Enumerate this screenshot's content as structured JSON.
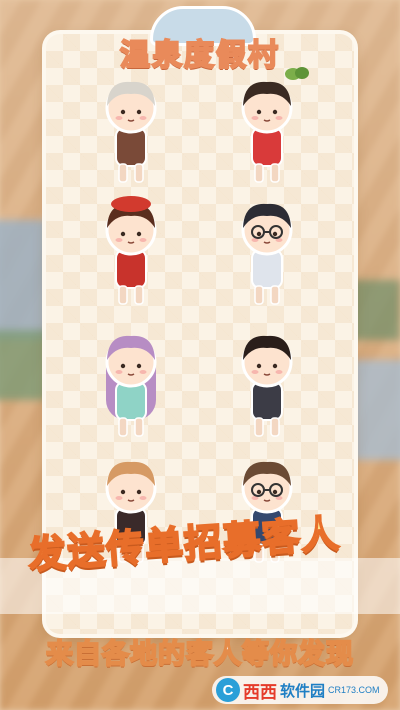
{
  "game": {
    "title": "温泉度假村",
    "slogan_primary": "发送传单招募客人",
    "slogan_secondary": "来自各地的客人等你发现"
  },
  "characters": [
    {
      "name": "grandma",
      "hair": "#d8d4cc",
      "outfit": "#7a4a38"
    },
    {
      "name": "qipao-girl",
      "hair": "#3a2a22",
      "outfit": "#d93a3a"
    },
    {
      "name": "beret-girl",
      "hair": "#5a2e1e",
      "outfit": "#c8332c",
      "hat": "#d23a2e"
    },
    {
      "name": "glasses-man",
      "hair": "#2c2c34",
      "outfit": "#dfe4ec"
    },
    {
      "name": "yukata-girl",
      "hair": "#b78dc4",
      "outfit": "#8fd3c6"
    },
    {
      "name": "kimono-boy",
      "hair": "#2a1e1a",
      "outfit": "#3c3c46"
    },
    {
      "name": "maid-girl",
      "hair": "#d69a64",
      "outfit": "#3a2a2a"
    },
    {
      "name": "office-lady",
      "hair": "#6b4a34",
      "outfit": "#34486e"
    }
  ],
  "watermark": {
    "logo_letter": "C",
    "brand_red": "西西",
    "brand_blue": "软件园",
    "domain": "CR173.COM"
  },
  "colors": {
    "accent_orange": "#e86e2a",
    "title_stroke": "#e98a5a",
    "card_bg": "#fbf3e6"
  }
}
